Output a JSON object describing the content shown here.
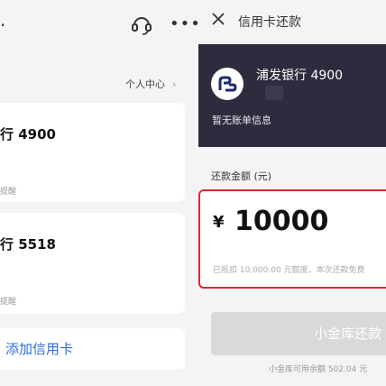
{
  "left": {
    "personal_center": "个人中心",
    "chevron": "›",
    "cards": [
      {
        "name": "行 4900",
        "hint": "提醒"
      },
      {
        "name": "行 5518",
        "hint": "提醒"
      }
    ],
    "add_card": "添加信用卡"
  },
  "panel": {
    "title": "信用卡还款",
    "bank_name": "浦发银行 4900",
    "no_bill": "暂无账单信息",
    "amount_label": "还款金额 (元)",
    "currency": "¥",
    "amount": "10000",
    "amount_note": "已抵扣 10,000.00 元额度，本次还款免费",
    "repay_button": "小金库还款",
    "balance_note": "小金库可用余额 502.04 元"
  },
  "colors": {
    "accent_red": "#e0262a",
    "link_blue": "#2f6de0",
    "card_dark": "#2d2b3d"
  },
  "icons": [
    "close-icon",
    "headset-icon",
    "more-icon",
    "bank-logo-icon",
    "chevron-right-icon"
  ]
}
